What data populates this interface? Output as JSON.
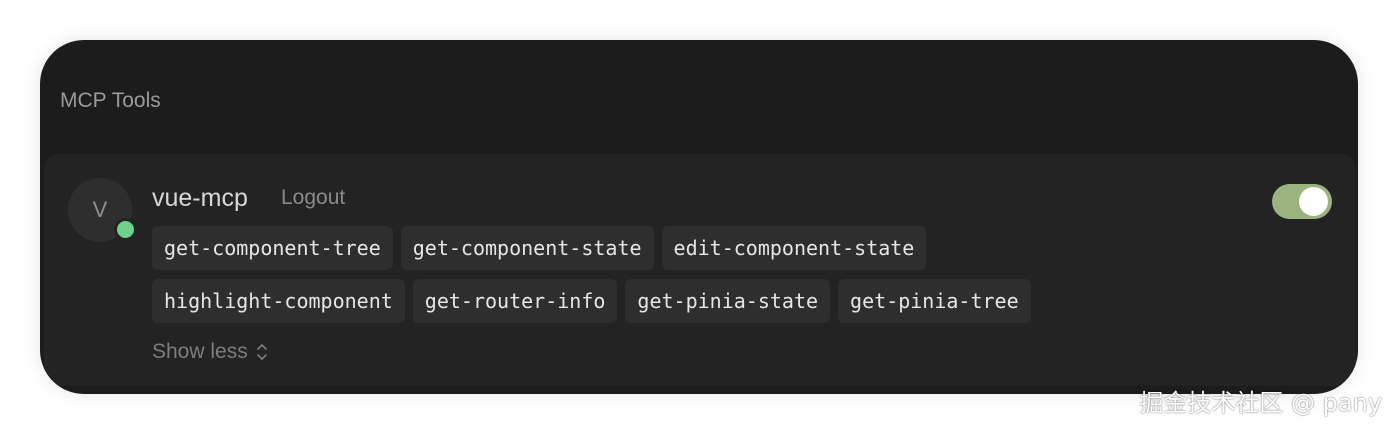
{
  "panel": {
    "title": "MCP Tools"
  },
  "server": {
    "avatar_letter": "V",
    "status": "connected",
    "status_color": "#6fd28a",
    "name": "vue-mcp",
    "logout_label": "Logout",
    "enabled": true,
    "toggle_color": "#9ab37f",
    "tools_row1": [
      "get-component-tree",
      "get-component-state",
      "edit-component-state"
    ],
    "tools_row2": [
      "highlight-component",
      "get-router-info",
      "get-pinia-state",
      "get-pinia-tree"
    ],
    "show_less_label": "Show less",
    "show_less_icon": "chevron-up-down-icon"
  },
  "watermark": "掘金技术社区 @ pany"
}
